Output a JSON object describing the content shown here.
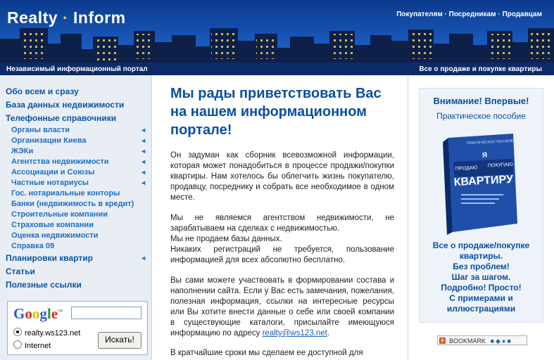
{
  "header": {
    "logo_part1": "Realty",
    "logo_sep": "·",
    "logo_part2": "Inform",
    "links": [
      "Покупателям",
      "Посредникам",
      "Продавцам"
    ],
    "link_sep": "·",
    "tagline_left": "Независимый информационный портал",
    "tagline_right": "Все о продаже и покупке квартиры"
  },
  "sidebar": {
    "top_items": [
      {
        "label": "Обо всем и сразу"
      },
      {
        "label": "База данных недвижимости"
      },
      {
        "label": "Телефонные справочники"
      }
    ],
    "sub_items": [
      {
        "label": "Органы власти",
        "arrow": "◄"
      },
      {
        "label": "Организации Киева",
        "arrow": "◄"
      },
      {
        "label": "ЖЭКи",
        "arrow": "◄"
      },
      {
        "label": "Агентства недвижимости",
        "arrow": "◄"
      },
      {
        "label": "Ассоциации и Союзы",
        "arrow": "◄"
      },
      {
        "label": "Частные нотариусы",
        "arrow": "◄"
      },
      {
        "label": "Гос. нотариальные конторы"
      },
      {
        "label": "Банки (недвижимость в кредит)"
      },
      {
        "label": "Строительные компании"
      },
      {
        "label": "Страховые компании"
      },
      {
        "label": "Оценка недвижимости"
      },
      {
        "label": "Справка 09"
      }
    ],
    "bottom_items": [
      {
        "label": "Планировки квартир",
        "arrow": "◄"
      },
      {
        "label": "Статьи"
      },
      {
        "label": "Полезные ссылки"
      }
    ]
  },
  "google": {
    "logo_letters": [
      "G",
      "o",
      "o",
      "g",
      "l",
      "e"
    ],
    "logo_colors": [
      "#2a5bd7",
      "#d62a1e",
      "#f0b400",
      "#2a5bd7",
      "#2a9b2e",
      "#d62a1e"
    ],
    "tm": "™",
    "search_value": "",
    "radio_site": "realty.ws123.net",
    "radio_internet": "Internet",
    "button": "Искать!"
  },
  "main": {
    "welcome": "Мы рады приветствовать Вас на нашем информационном портале!",
    "para1": "Он задуман как сборник всевозможной информации, которая может понадобиться в процессе продажи/покупки квартиры. Нам хотелось бы облегчить жизнь покупателю, продавцу, посреднику и собрать все необходимое в одном месте.",
    "para2_lines": [
      "Мы не являемся агентством недвижимости, не зарабатываем на сделках с недвижимостью.",
      "Мы не продаем базы данных.",
      "Никаких регистраций не требуется, пользование информацией для всех абсолютно бесплатно."
    ],
    "para3": "Вы сами можете участвовать в формировании состава и наполнении сайта. Если у Вас есть замечания, пожелания, полезная информация, ссылки на интересные ресурсы или Вы хотите внести данные о себе или своей компании в существующие каталоги, присылайте имеющуюся информацию по адресу",
    "email": "realty@ws123.net",
    "para3_end": ".",
    "para4": "В кратчайшие сроки мы сделаем ее доступной для"
  },
  "promo": {
    "heading": "Внимание! Впервые!",
    "subheading": "Практическое пособие",
    "book_small": "ПРАКТИЧЕСКОЕ ПОСОБИЕ",
    "book_ya": "Я",
    "book_prodau": "ПРОДАЮ",
    "book_pokupau": "ПОКУПАЮ",
    "book_title": "КВАРТИРУ",
    "lines": [
      "Все о продаже/покупке",
      "квартиры.",
      "Без проблем!",
      "Шаг за шагом.",
      "Подробно! Просто!",
      "С примерами и",
      "иллюстрациями"
    ],
    "bookmark": "BOOKMARK",
    "bookmark_plus": "+"
  },
  "colors": {
    "link": "#0a55a3",
    "header_bg": "#1a5bbf",
    "sidebar_bg": "#e9eef4",
    "promo_bg": "#edf3f8"
  }
}
